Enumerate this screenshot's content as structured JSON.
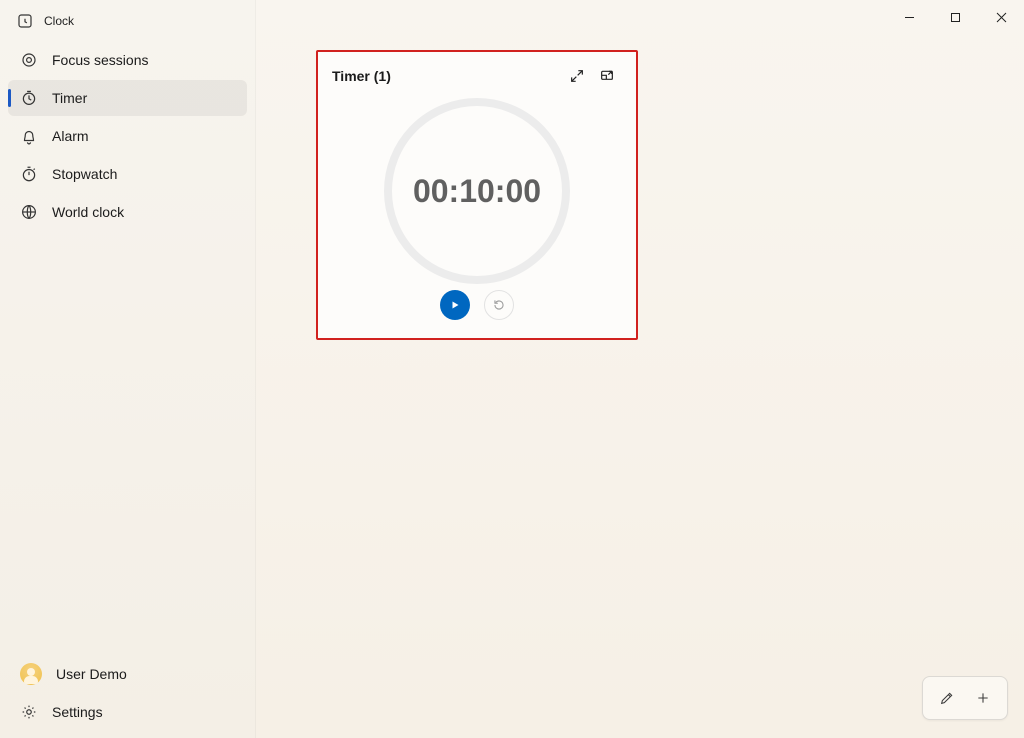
{
  "app": {
    "title": "Clock"
  },
  "sidebar": {
    "items": [
      {
        "label": "Focus sessions"
      },
      {
        "label": "Timer"
      },
      {
        "label": "Alarm"
      },
      {
        "label": "Stopwatch"
      },
      {
        "label": "World clock"
      }
    ],
    "active_index": 1,
    "user_label": "User Demo",
    "settings_label": "Settings"
  },
  "timer": {
    "title": "Timer (1)",
    "time": "00:10:00"
  },
  "colors": {
    "accent": "#0067c0",
    "highlight_border": "#d1211e"
  }
}
